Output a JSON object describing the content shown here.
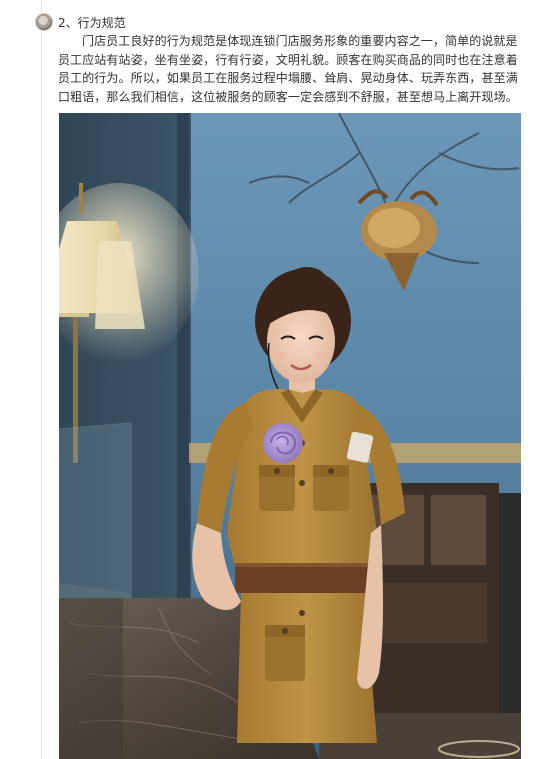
{
  "section": {
    "number": "2、",
    "title": "行为规范"
  },
  "paragraph": "门店员工良好的行为规范是体现连锁门店服务形象的重要内容之一，简单的说就是员工应站有站姿，坐有坐姿，行有行姿，文明礼貌。顾客在购买商品的同时也在注意着员工的行为。所以，如果员工在服务过程中塌腰、耸肩、晃动身体、玩弄东西，甚至满口粗语，那么我们相信，这位被服务的顾客一定会感到不舒服，甚至想马上离开现场。",
  "photo": {
    "subject": "smiling-staff-in-khaki-uniform",
    "colors": {
      "wall_blue": "#5a86a8",
      "uniform_khaki": "#b5893c",
      "belt_brown": "#6b3f24",
      "flower_purple": "#a98fd0",
      "lamp_shade": "#efe3c0",
      "marble": "#5a5248"
    }
  }
}
